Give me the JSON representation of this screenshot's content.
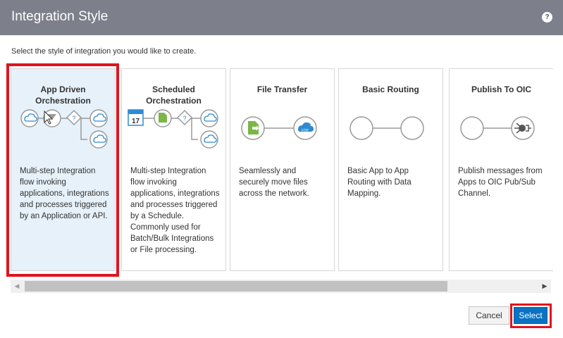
{
  "dialog": {
    "title": "Integration Style",
    "help_icon": "?",
    "instruction": "Select the style of integration you would like to create."
  },
  "cards": [
    {
      "title_line1": "App Driven",
      "title_line2": "Orchestration",
      "description": "Multi-step Integration flow invoking applications, integrations and processes triggered by an Application or API.",
      "selected": true
    },
    {
      "title_line1": "Scheduled",
      "title_line2": "Orchestration",
      "calendar_day": "17",
      "description": "Multi-step Integration flow invoking applications, integrations and processes triggered by a Schedule. Commonly used for Batch/Bulk Integrations or File processing.",
      "selected": false
    },
    {
      "title_line1": "File Transfer",
      "title_line2": "",
      "description": "Seamlessly and securely move files across the network.",
      "selected": false
    },
    {
      "title_line1": "Basic Routing",
      "title_line2": "",
      "description": "Basic App to App Routing with Data Mapping.",
      "selected": false
    },
    {
      "title_line1": "Publish To OIC",
      "title_line2": "",
      "description": "Publish messages from Apps to OIC Pub/Sub Channel.",
      "selected": false
    }
  ],
  "buttons": {
    "cancel": "Cancel",
    "select": "Select"
  },
  "colors": {
    "header_bg": "#7d7f8a",
    "accent_blue": "#0a72c2",
    "highlight_red": "#e0141e",
    "icon_blue": "#2e8bd2",
    "icon_green": "#7ab648"
  }
}
